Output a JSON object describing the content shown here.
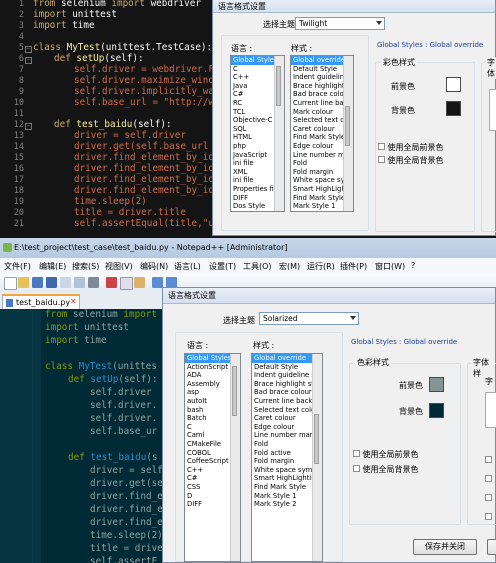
{
  "top_editor": {
    "theme": "Twilight",
    "line_numbers": [
      "1",
      "2",
      "3",
      "4",
      "5",
      "6",
      "7",
      "8",
      "9",
      "10",
      "11",
      "12",
      "13",
      "14",
      "15",
      "16",
      "17",
      "18",
      "19",
      "20",
      "21"
    ]
  },
  "top_dialog": {
    "title": "语言格式设置",
    "theme_label": "选择主题",
    "theme_value": "Twilight",
    "language_label": "语言 :",
    "style_label": "样式 :",
    "languages": [
      "Global Styles",
      "C",
      "C++",
      "Java",
      "C#",
      "RC",
      "TCL",
      "Objective-C",
      "SQL",
      "HTML",
      "php",
      "JavaScript",
      "ini file",
      "XML",
      "ini file",
      "Properties file",
      "DIFF",
      "Dos Style"
    ],
    "styles": [
      "Global override",
      "Default Style",
      "Indent guideline sty",
      "Brace highlight style",
      "Bad brace colour",
      "Current line backgr",
      "Mark colour",
      "Selected text colou",
      "Caret colour",
      "Find Mark Style",
      "Edge colour",
      "Line number margin",
      "Fold",
      "Fold margin",
      "White space symbo",
      "Smart HighLighting",
      "Find Mark Style",
      "Mark Style 1"
    ],
    "header_text": "Global Styles : Global override",
    "color_group": "彩色样式",
    "font_group_partial": "字体",
    "fg_label": "前景色",
    "bg_label": "背景色",
    "use_global_fg": "使用全局前景色",
    "use_global_bg": "使用全局背景色",
    "fg_color": "#ffffff",
    "bg_color": "#141414"
  },
  "notepad": {
    "title": "E:\\test_project\\test_case\\test_baidu.py - Notepad++ [Administrator]",
    "menu": [
      "文件(F)",
      "编辑(E)",
      "搜索(S)",
      "视图(V)",
      "编码(N)",
      "语言(L)",
      "设置(T)",
      "工具(O)",
      "宏(M)",
      "运行(R)",
      "插件(P)",
      "窗口(W)",
      "?"
    ],
    "tab": "test_baidu.py",
    "close_symbol": "✕",
    "theme": "Solarized"
  },
  "bottom_dialog": {
    "title": "语言格式设置",
    "theme_label": "选择主题",
    "theme_value": "Solarized",
    "language_label": "语言 :",
    "style_label": "样式 :",
    "languages": [
      "Global Styles",
      "ActionScript",
      "ADA",
      "Assembly",
      "asp",
      "autoIt",
      "bash",
      "Batch",
      "C",
      "Caml",
      "CMakeFile",
      "COBOL",
      "CoffeeScript",
      "C++",
      "C#",
      "CSS",
      "D",
      "DIFF"
    ],
    "styles": [
      "Global override",
      "Default Style",
      "Indent guideline sty",
      "Brace highlight style",
      "Bad brace colour",
      "Current line backgr",
      "Selected text colou",
      "Caret colour",
      "Edge colour",
      "Line number margin",
      "Fold",
      "Fold active",
      "Fold margin",
      "White space symbo",
      "Smart HighLighting",
      "Find Mark Style",
      "Mark Style 1",
      "Mark Style 2"
    ],
    "header_text": "Global Styles : Global override",
    "color_group": "色彩样式",
    "font_group_partial": "字体样",
    "font_partial": "字",
    "fg_label": "前景色",
    "bg_label": "背景色",
    "use_global_fg": "使用全局前景色",
    "use_global_bg": "使用全局背景色",
    "save_close": "保存并关闭",
    "fg_color": "#839496",
    "bg_color": "#002b36"
  }
}
